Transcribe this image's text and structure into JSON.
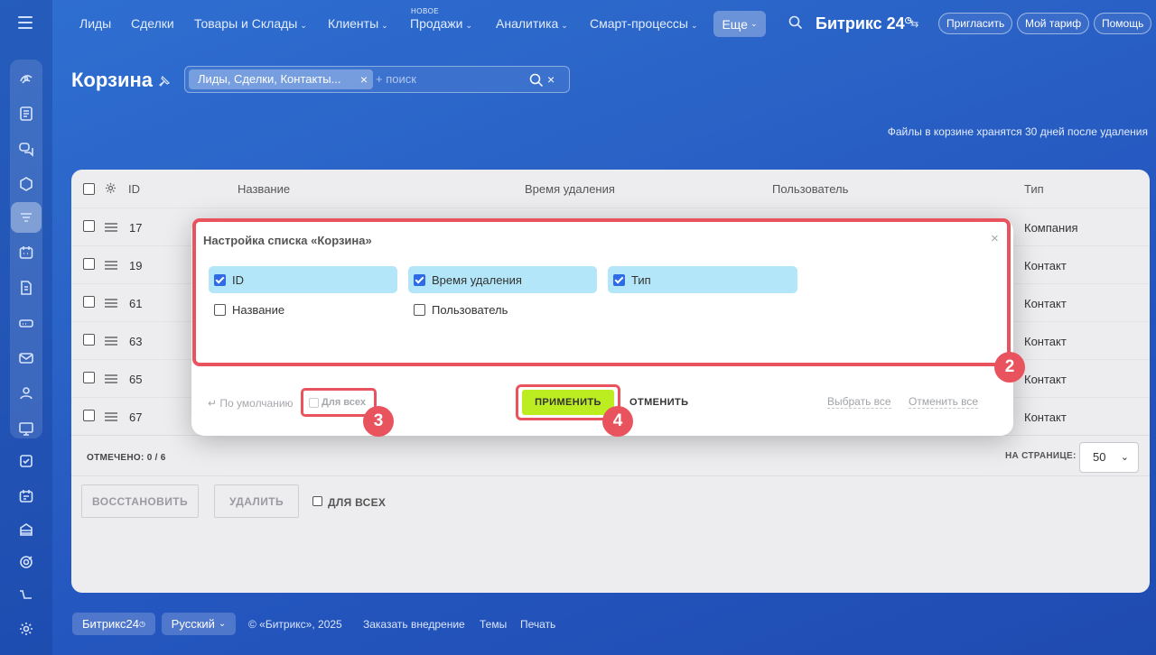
{
  "topbar": {
    "nav": [
      "Лиды",
      "Сделки",
      "Товары и Склады",
      "Клиенты",
      "Продажи",
      "Аналитика",
      "Смарт-процессы"
    ],
    "badge_new": "НОВОЕ",
    "more": "Еще",
    "brand": "Битрикс 24",
    "invite": "Пригласить",
    "tariff": "Мой тариф",
    "help": "Помощь"
  },
  "page": {
    "title": "Корзина",
    "filter_chip": "Лиды, Сделки, Контакты...",
    "filter_placeholder": "+ поиск",
    "files_note": "Файлы в корзине хранятся 30 дней после удаления"
  },
  "grid": {
    "columns": [
      "ID",
      "Название",
      "Время удаления",
      "Пользователь",
      "Тип"
    ],
    "rows": [
      {
        "id": "17",
        "type": "Компания"
      },
      {
        "id": "19",
        "type": "Контакт"
      },
      {
        "id": "61",
        "type": "Контакт"
      },
      {
        "id": "63",
        "type": "Контакт"
      },
      {
        "id": "65",
        "type": "Контакт"
      },
      {
        "id": "67",
        "type": "Контакт"
      }
    ],
    "marked": "ОТМЕЧЕНО: 0 / 6",
    "per_page_label": "НА СТРАНИЦЕ:",
    "per_page_value": "50",
    "restore": "ВОССТАНОВИТЬ",
    "delete": "УДАЛИТЬ",
    "for_all": "ДЛЯ ВСЕХ"
  },
  "modal": {
    "title": "Настройка списка «Корзина»",
    "options": [
      {
        "label": "ID",
        "checked": true
      },
      {
        "label": "Время удаления",
        "checked": true
      },
      {
        "label": "Тип",
        "checked": true
      },
      {
        "label": "Название",
        "checked": false
      },
      {
        "label": "Пользователь",
        "checked": false
      }
    ],
    "reset": "По умолчанию",
    "for_all": "Для всех",
    "apply": "ПРИМЕНИТЬ",
    "cancel": "ОТМЕНИТЬ",
    "select_all": "Выбрать все",
    "unselect_all": "Отменить все",
    "steps": [
      "2",
      "3",
      "4"
    ]
  },
  "footer": {
    "brand": "Битрикс24",
    "language": "Русский",
    "copyright": "© «Битрикс», 2025",
    "order": "Заказать внедрение",
    "themes": "Темы",
    "print": "Печать"
  },
  "colors": {
    "accent_highlight": "#e8535e",
    "apply_button": "#bbed21",
    "checked_option": "#b3e6f8",
    "checkbox_on": "#2e6be4"
  }
}
